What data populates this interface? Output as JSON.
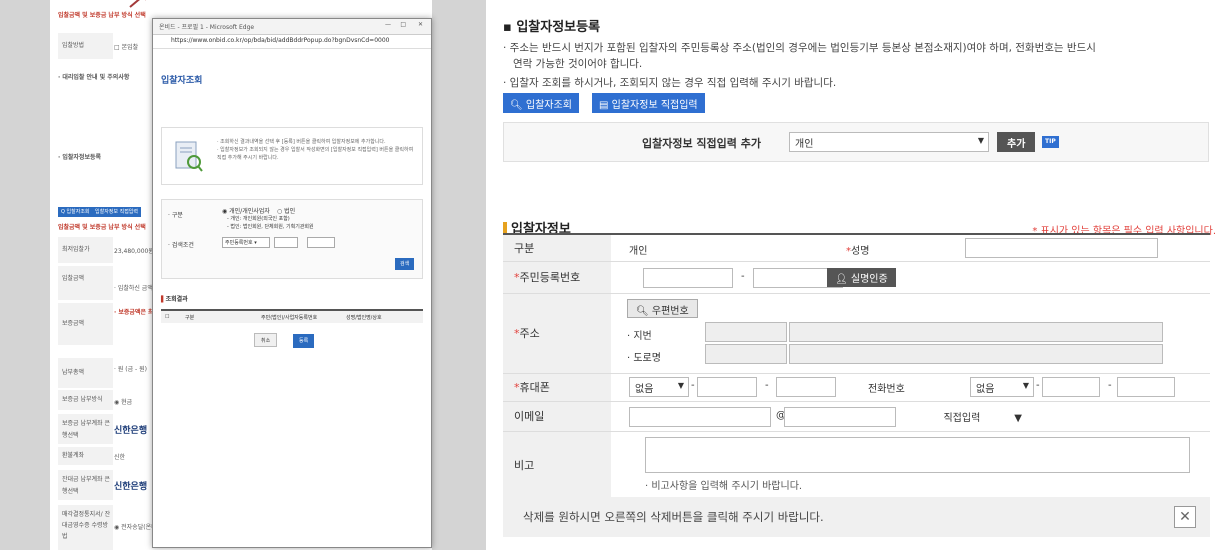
{
  "left_page": {
    "header": "입찰금액 및 보증금 납부 방식 선택",
    "rows": [
      {
        "label": "입찰방법",
        "value": "□ 본입찰"
      },
      {
        "label": "최저입찰가",
        "value": "23,480,000원"
      },
      {
        "label": "입찰금액",
        "value": "· 입찰하신 금액을"
      },
      {
        "label": "보증금액",
        "value": "· 보증금액은 최저"
      },
      {
        "label": "납부총액",
        "value": "· 원 (금 - 원)"
      },
      {
        "label": "보증금 납부방식",
        "value": "◉ 현금"
      },
      {
        "label": "보증금 납부계좌 은행선택",
        "value": "신한은행"
      },
      {
        "label": "환불계좌",
        "value": "신한"
      },
      {
        "label": "잔대금 납부계좌 은행선택",
        "value": "신한은행"
      },
      {
        "label": "매각결정통지서/ 잔대금영수증 수령방법",
        "value": "◉ 전자송달(온비"
      }
    ],
    "section1": "· 대리입찰 안내 및 주의사항",
    "section2": "· 입찰자정보등록",
    "btn1": "Q 입찰자조회",
    "btn2": "입찰자정보 직접입력",
    "section3": "입찰금액 및 보증금 납부 방식 선택"
  },
  "popup": {
    "window_title": "온비드 - 프로필 1 - Microsoft Edge",
    "url": "https://www.onbid.co.kr/op/bda/bid/addBddrPopup.do?bgnDvsnCd=0000",
    "title": "입찰자조회",
    "notice": [
      "· 조회하신 결과내역을 선택 후 [등록] 버튼을 클릭하여 입찰자정보에 추가합니다.",
      "· 입찰자정보가 조회되지 않는 경우 입찰서 작성화면의 [입찰자정보 직접입력] 버튼을 클릭하여",
      "  직접 추가해 주시기 바랍니다."
    ],
    "kind_label": "· 구분",
    "kind_opts": [
      "◉ 개인/개인사업자",
      "○ 법인"
    ],
    "kind_notes": [
      "- 개인: 개인회원(외국인 포함)",
      "- 법인: 법인회원, 단체회원, 기획기관회원"
    ],
    "cond_label": "· 검색조건",
    "cond_select": "주민등록번호",
    "search_btn": "검색",
    "result_title": "조회결과",
    "cols": [
      "구분",
      "주민(법인)/사업자등록번호",
      "성명/법인명/상호"
    ],
    "cancel_btn": "취소",
    "register_btn": "등록"
  },
  "main": {
    "title": "▪ 입찰자정보등록",
    "desc1": "· 주소는 반드시 번지가 포함된 입찰자의 주민등록상 주소(법인의 경우에는 법인등기부 등본상 본점소재지)여야 하며, 전화번호는 반드시",
    "desc2": "연락 가능한 것이어야 합니다.",
    "desc3": "· 입찰자 조회를 하시거나, 조회되지 않는 경우 직접 입력해 주시기 바랍니다.",
    "btn_lookup": "입찰자조회",
    "btn_direct": "입찰자정보 직접입력",
    "add_label": "입찰자정보 직접입력 추가",
    "add_select": "개인",
    "add_btn": "추가",
    "tip": "TIP",
    "section_title": "입찰자정보",
    "required_note": "* 표시가 있는 항목은 필수 입력 사항입니다.",
    "form": {
      "kind_label": "구분",
      "kind_value": "개인",
      "name_label": "성명",
      "rrn_label": "주민등록번호",
      "verify_btn": "실명인증",
      "addr_label": "주소",
      "zip_btn": "우편번호",
      "jibun_label": "· 지번",
      "road_label": "· 도로명",
      "mobile_label": "휴대폰",
      "mobile_select": "없음",
      "phone_label": "전화번호",
      "phone_select": "없음",
      "email_label": "이메일",
      "email_at": "@",
      "email_domain": "직접입력",
      "note_label": "비고",
      "note_hint": "· 비고사항을 입력해 주시기 바랍니다."
    },
    "delete_msg": "삭제를 원하시면 오른쪽의 삭제버튼을 클릭해 주시기 바랍니다.",
    "dash": "-",
    "star": "*"
  },
  "colors": {
    "accent": "#2f6fd1",
    "required": "#e2403b",
    "arrow": "#a33a3a"
  }
}
